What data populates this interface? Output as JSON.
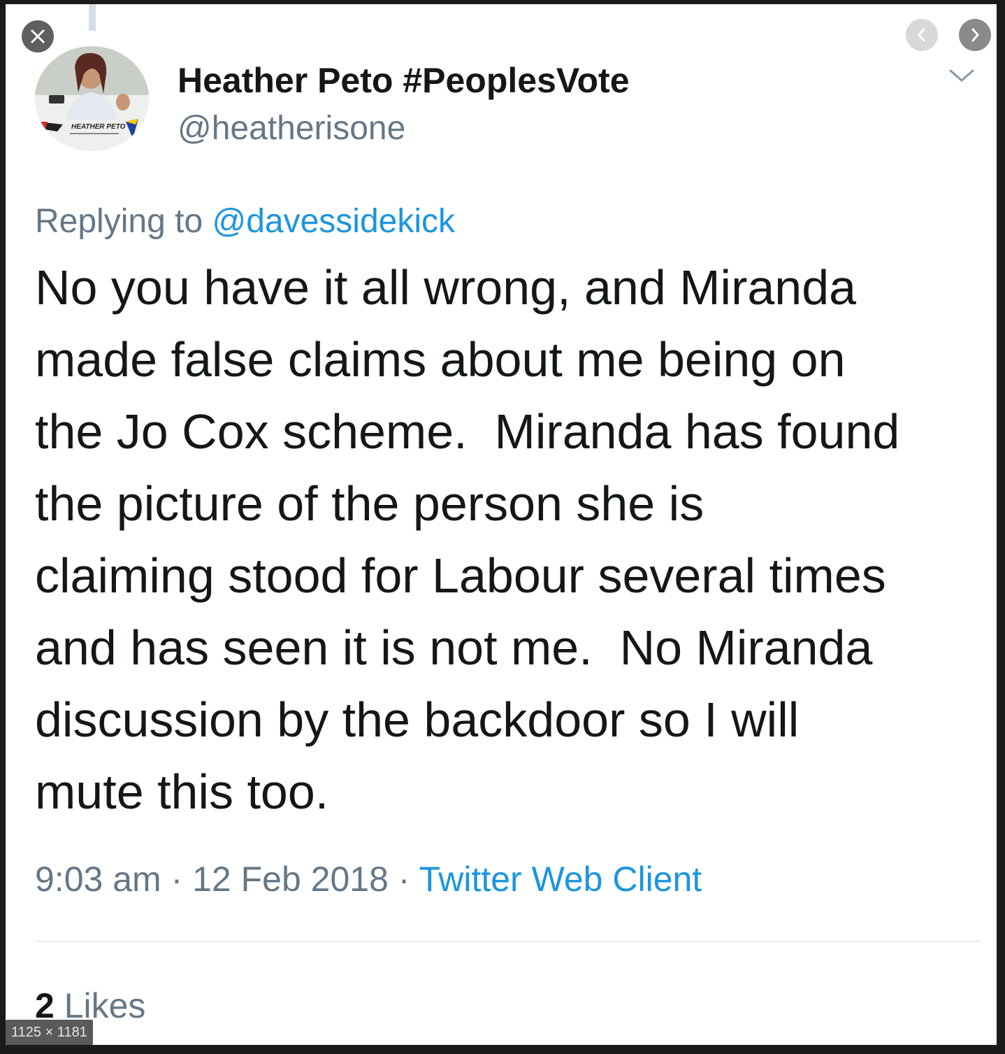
{
  "viewer": {
    "dimensions_label": "1125 × 1181",
    "close_icon": "close-icon",
    "prev_icon": "chevron-left-icon",
    "next_icon": "chevron-right-icon"
  },
  "tweet": {
    "display_name": "Heather Peto #PeoplesVote",
    "handle": "@heatherisone",
    "avatar_banner_text": "HEATHER PETO",
    "replying_prefix": "Replying to ",
    "replying_to": "@davessidekick",
    "body_lines": [
      "No you have it all wrong, and Miranda",
      "made false claims about me being on",
      "the Jo Cox scheme.  Miranda has found",
      "the picture of the person she is",
      "claiming stood for Labour several times",
      "and has seen it is not me.  No Miranda",
      "discussion by the backdoor so I will",
      "mute this too."
    ],
    "time": "9:03 am",
    "separator": " · ",
    "date": "12 Feb 2018",
    "source": "Twitter Web Client",
    "likes_count": "2",
    "likes_label": " Likes"
  },
  "colors": {
    "text_primary": "#14171a",
    "text_secondary": "#657786",
    "link": "#1b95e0",
    "divider": "#e6ecf0"
  }
}
